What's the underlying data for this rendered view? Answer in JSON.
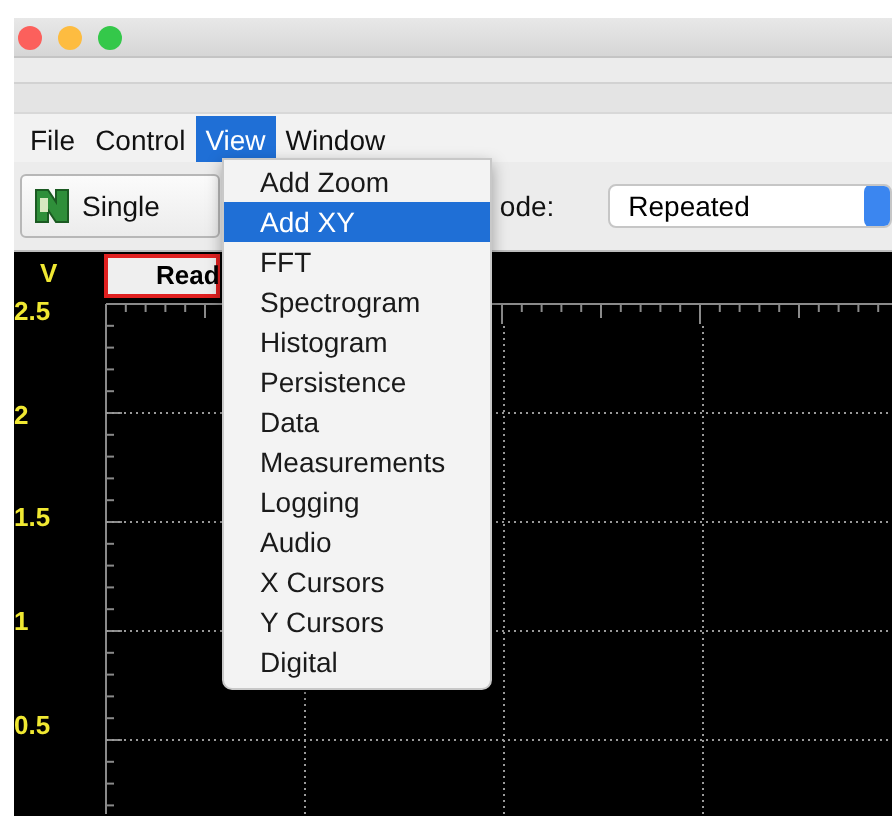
{
  "window": {
    "controls": [
      {
        "color": "#fc605c"
      },
      {
        "color": "#fdbc40"
      },
      {
        "color": "#34c84a"
      }
    ]
  },
  "menu_bar": [
    {
      "label": "File",
      "selected": false
    },
    {
      "label": "Control",
      "selected": false
    },
    {
      "label": "View",
      "selected": true
    },
    {
      "label": "Window",
      "selected": false
    }
  ],
  "toolbar": {
    "single_button": "Single",
    "mode_label": "ode:",
    "mode_select": {
      "value": "Repeated"
    }
  },
  "scope": {
    "unit": "V",
    "status": "Read",
    "y_labels": [
      "2.5",
      "2",
      "1.5",
      "1",
      "0.5"
    ]
  },
  "view_menu": {
    "items": [
      {
        "label": "Add Zoom",
        "selected": false
      },
      {
        "label": "Add XY",
        "selected": true
      },
      {
        "label": "FFT",
        "selected": false
      },
      {
        "label": "Spectrogram",
        "selected": false
      },
      {
        "label": "Histogram",
        "selected": false
      },
      {
        "label": "Persistence",
        "selected": false
      },
      {
        "label": "Data",
        "selected": false
      },
      {
        "label": "Measurements",
        "selected": false
      },
      {
        "label": "Logging",
        "selected": false
      },
      {
        "label": "Audio",
        "selected": false
      },
      {
        "label": "X Cursors",
        "selected": false
      },
      {
        "label": "Y Cursors",
        "selected": false
      },
      {
        "label": "Digital",
        "selected": false
      }
    ]
  }
}
